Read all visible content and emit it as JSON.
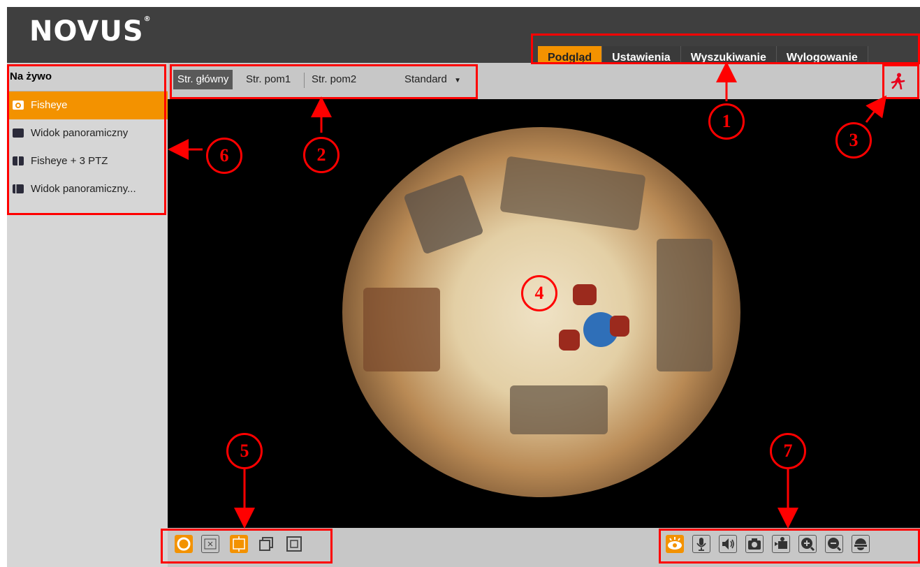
{
  "header": {
    "logo_text": "NOVUS"
  },
  "nav": {
    "tabs": [
      {
        "label": "Podgląd",
        "active": true
      },
      {
        "label": "Ustawienia"
      },
      {
        "label": "Wyszukiwanie"
      },
      {
        "label": "Wylogowanie"
      }
    ]
  },
  "sidebar": {
    "title": "Na żywo",
    "items": [
      {
        "label": "Fisheye",
        "icon": "fisheye-icon",
        "active": true
      },
      {
        "label": "Widok panoramiczny",
        "icon": "panorama-icon"
      },
      {
        "label": "Fisheye + 3 PTZ",
        "icon": "fisheye-ptz-icon"
      },
      {
        "label": "Widok panoramiczny...",
        "icon": "panorama-ptz-icon"
      }
    ]
  },
  "streams": {
    "tabs": [
      "Str. główny",
      "Str. pom1",
      "Str. pom2"
    ],
    "active": "Str. główny",
    "quality": "Standard"
  },
  "callouts": [
    "1",
    "2",
    "3",
    "4",
    "5",
    "6",
    "7"
  ],
  "colors": {
    "accent": "#f39200",
    "annotation": "#ff0000",
    "header": "#3f3f3f"
  }
}
